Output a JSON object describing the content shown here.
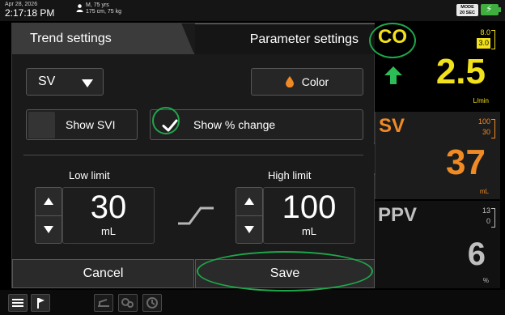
{
  "status": {
    "date": "Apr 28, 2026",
    "time": "2:17:18 PM",
    "patient_line1": "M, 75 yrs",
    "patient_line2": "175 cm, 75 kg",
    "mode_label": "MODE",
    "mode_value": "20 SEC"
  },
  "tabs": {
    "trend": "Trend settings",
    "parameter": "Parameter settings"
  },
  "settings": {
    "parameter": "SV",
    "color_label": "Color",
    "show_svi": "Show SVI",
    "show_pct": "Show % change",
    "show_svi_checked": false,
    "show_pct_checked": true
  },
  "limits": {
    "low_label": "Low limit",
    "high_label": "High limit",
    "low_value": "30",
    "high_value": "100",
    "unit": "mL"
  },
  "actions": {
    "cancel": "Cancel",
    "save": "Save"
  },
  "tiles": [
    {
      "name": "CO",
      "upper": "8.0",
      "lower": "3.0",
      "value": "2.5",
      "unit": "L/min",
      "color": "#f2e21b",
      "trend": "up"
    },
    {
      "name": "SV",
      "upper": "100",
      "lower": "30",
      "value": "37",
      "unit": "mL",
      "color": "#f08a24"
    },
    {
      "name": "PPV",
      "upper": "13",
      "lower": "0",
      "value": "6",
      "unit": "%",
      "color": "#bfbfbf"
    }
  ],
  "colors": {
    "accent_green": "#1fa64a",
    "battery_green": "#3fae3f",
    "drop_orange": "#f08a24"
  }
}
